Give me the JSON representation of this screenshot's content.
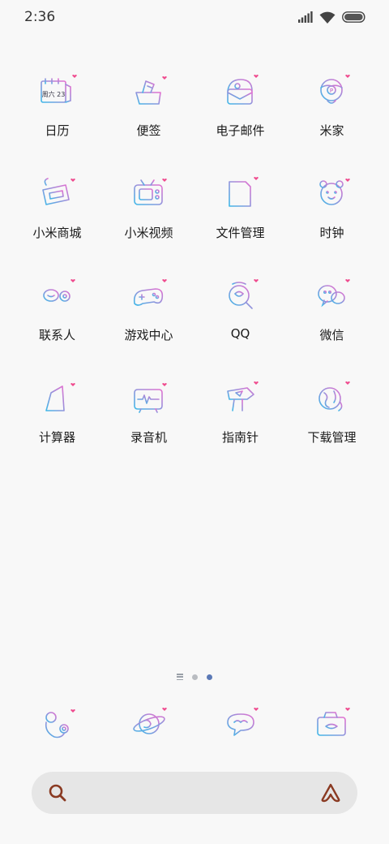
{
  "status_bar": {
    "time": "2:36",
    "icons": [
      "signal-icon",
      "wifi-icon",
      "battery-icon"
    ]
  },
  "apps": [
    {
      "label": "日历",
      "icon": "calendar-icon",
      "icon_text": "周六 23"
    },
    {
      "label": "便签",
      "icon": "notes-icon"
    },
    {
      "label": "电子邮件",
      "icon": "mail-icon"
    },
    {
      "label": "米家",
      "icon": "mijia-icon"
    },
    {
      "label": "小米商城",
      "icon": "mall-icon"
    },
    {
      "label": "小米视频",
      "icon": "video-icon"
    },
    {
      "label": "文件管理",
      "icon": "file-manager-icon"
    },
    {
      "label": "时钟",
      "icon": "clock-icon"
    },
    {
      "label": "联系人",
      "icon": "contacts-icon"
    },
    {
      "label": "游戏中心",
      "icon": "game-center-icon"
    },
    {
      "label": "QQ",
      "icon": "qq-icon"
    },
    {
      "label": "微信",
      "icon": "wechat-icon"
    },
    {
      "label": "计算器",
      "icon": "calculator-icon"
    },
    {
      "label": "录音机",
      "icon": "recorder-icon"
    },
    {
      "label": "指南针",
      "icon": "compass-icon"
    },
    {
      "label": "下载管理",
      "icon": "download-manager-icon"
    }
  ],
  "pager": {
    "pages": 2,
    "active_page": 2
  },
  "dock": [
    {
      "icon": "phone-icon"
    },
    {
      "icon": "browser-icon"
    },
    {
      "icon": "messages-icon"
    },
    {
      "icon": "camera-icon"
    }
  ],
  "search_bar": {
    "left_icon": "search-icon",
    "right_icon": "assistant-icon"
  },
  "colors": {
    "background": "#f8f8f8",
    "icon_gradient_start": "#3fb8e8",
    "icon_gradient_end": "#e46fd0",
    "heart": "#ef4a8e",
    "search_accent": "#8a3a22",
    "pager_active": "#5b79b6"
  }
}
